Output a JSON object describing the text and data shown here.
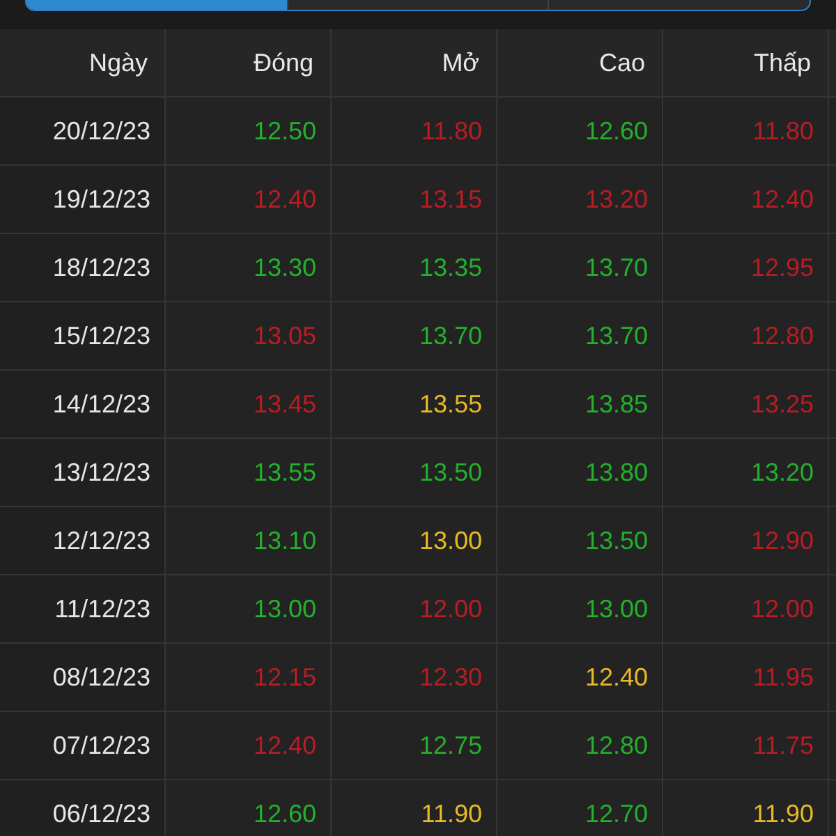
{
  "segments": [
    {
      "selected": true
    },
    {
      "selected": false
    },
    {
      "selected": false
    }
  ],
  "table": {
    "columns": [
      "Ngày",
      "Đóng",
      "Mở",
      "Cao",
      "Thấp"
    ],
    "rows": [
      {
        "cells": [
          {
            "text": "20/12/23"
          },
          {
            "text": "12.50",
            "color": "#23b02b"
          },
          {
            "text": "11.80",
            "color": "#b81d24"
          },
          {
            "text": "12.60",
            "color": "#23b02b"
          },
          {
            "text": "11.80",
            "color": "#b81d24"
          }
        ]
      },
      {
        "cells": [
          {
            "text": "19/12/23"
          },
          {
            "text": "12.40",
            "color": "#b81d24"
          },
          {
            "text": "13.15",
            "color": "#b81d24"
          },
          {
            "text": "13.20",
            "color": "#b81d24"
          },
          {
            "text": "12.40",
            "color": "#b81d24"
          }
        ]
      },
      {
        "cells": [
          {
            "text": "18/12/23"
          },
          {
            "text": "13.30",
            "color": "#23b02b"
          },
          {
            "text": "13.35",
            "color": "#23b02b"
          },
          {
            "text": "13.70",
            "color": "#23b02b"
          },
          {
            "text": "12.95",
            "color": "#b81d24"
          }
        ]
      },
      {
        "cells": [
          {
            "text": "15/12/23"
          },
          {
            "text": "13.05",
            "color": "#b81d24"
          },
          {
            "text": "13.70",
            "color": "#23b02b"
          },
          {
            "text": "13.70",
            "color": "#23b02b"
          },
          {
            "text": "12.80",
            "color": "#b81d24"
          }
        ]
      },
      {
        "cells": [
          {
            "text": "14/12/23"
          },
          {
            "text": "13.45",
            "color": "#b81d24"
          },
          {
            "text": "13.55",
            "color": "#e8b923"
          },
          {
            "text": "13.85",
            "color": "#23b02b"
          },
          {
            "text": "13.25",
            "color": "#b81d24"
          }
        ]
      },
      {
        "cells": [
          {
            "text": "13/12/23"
          },
          {
            "text": "13.55",
            "color": "#23b02b"
          },
          {
            "text": "13.50",
            "color": "#23b02b"
          },
          {
            "text": "13.80",
            "color": "#23b02b"
          },
          {
            "text": "13.20",
            "color": "#23b02b"
          }
        ]
      },
      {
        "cells": [
          {
            "text": "12/12/23"
          },
          {
            "text": "13.10",
            "color": "#23b02b"
          },
          {
            "text": "13.00",
            "color": "#e8b923"
          },
          {
            "text": "13.50",
            "color": "#23b02b"
          },
          {
            "text": "12.90",
            "color": "#b81d24"
          }
        ]
      },
      {
        "cells": [
          {
            "text": "11/12/23"
          },
          {
            "text": "13.00",
            "color": "#23b02b"
          },
          {
            "text": "12.00",
            "color": "#b81d24"
          },
          {
            "text": "13.00",
            "color": "#23b02b"
          },
          {
            "text": "12.00",
            "color": "#b81d24"
          }
        ]
      },
      {
        "cells": [
          {
            "text": "08/12/23"
          },
          {
            "text": "12.15",
            "color": "#b81d24"
          },
          {
            "text": "12.30",
            "color": "#b81d24"
          },
          {
            "text": "12.40",
            "color": "#e8b923"
          },
          {
            "text": "11.95",
            "color": "#b81d24"
          }
        ]
      },
      {
        "cells": [
          {
            "text": "07/12/23"
          },
          {
            "text": "12.40",
            "color": "#b81d24"
          },
          {
            "text": "12.75",
            "color": "#23b02b"
          },
          {
            "text": "12.80",
            "color": "#23b02b"
          },
          {
            "text": "11.75",
            "color": "#b81d24"
          }
        ]
      },
      {
        "cells": [
          {
            "text": "06/12/23"
          },
          {
            "text": "12.60",
            "color": "#23b02b"
          },
          {
            "text": "11.90",
            "color": "#e8b923"
          },
          {
            "text": "12.70",
            "color": "#23b02b"
          },
          {
            "text": "11.90",
            "color": "#e8b923"
          }
        ]
      }
    ]
  }
}
